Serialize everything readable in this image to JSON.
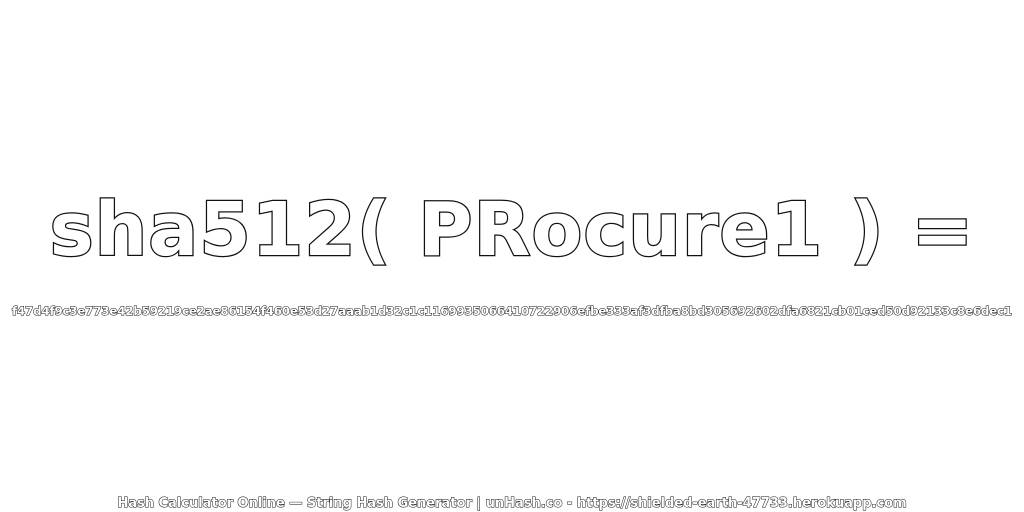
{
  "heading": {
    "expression": "sha512( PRocure1 ) ="
  },
  "result": {
    "hash": "f47d4f9c3e773e42b59219ce2ae86154f460e53d27aaab1d32c1c1169935066410722906efbe333af3dfba8bd305692602dfa6821cb01ced50d92133c8e6dec1"
  },
  "footer": {
    "text": "Hash Calculator Online — String Hash Generator | unHash.co - https://shielded-earth-47733.herokuapp.com"
  }
}
